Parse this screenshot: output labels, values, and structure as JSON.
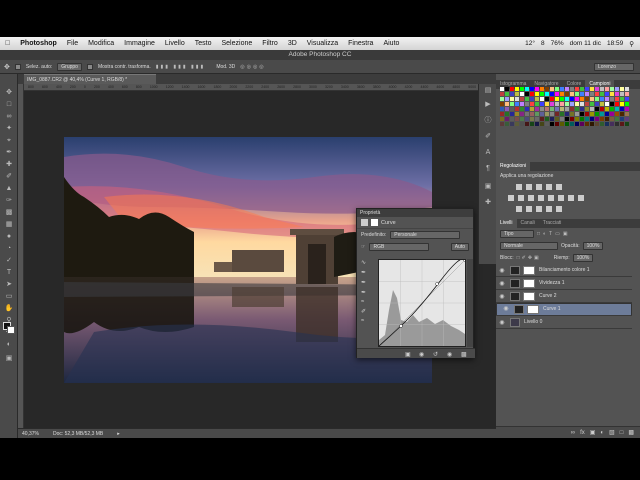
{
  "menubar": {
    "app": "Photoshop",
    "items": [
      "File",
      "Modifica",
      "Immagine",
      "Livello",
      "Testo",
      "Selezione",
      "Filtro",
      "3D",
      "Visualizza",
      "Finestra",
      "Aiuto"
    ],
    "status": [
      "12°",
      "8",
      "76%",
      "dom 11 dic",
      "18:59"
    ]
  },
  "window": {
    "title": "Adobe Photoshop CC"
  },
  "options": {
    "auto_select_label": "Selez. auto:",
    "auto_select_value": "Gruppo",
    "transform_label": "Mostra contr. trasforma.",
    "mode_label": "Mod. 3D",
    "workspace": "Lorenzo"
  },
  "document": {
    "tab": "IMG_0887.CR2 @ 40,4% (Curve 1, RGB/8) *",
    "zoom": "40,37%",
    "doc_size": "Doc: 52,3 MB/52,3 MB"
  },
  "ruler_ticks": [
    "800",
    "600",
    "400",
    "200",
    "0",
    "200",
    "400",
    "600",
    "800",
    "1000",
    "1200",
    "1400",
    "1600",
    "1800",
    "2000",
    "2200",
    "2400",
    "2600",
    "2800",
    "3000",
    "3200",
    "3400",
    "3600",
    "3800",
    "4000",
    "4200",
    "4400",
    "4600",
    "4800",
    "5000",
    "5200"
  ],
  "properties": {
    "title": "Proprietà",
    "subtitle": "Curve",
    "preset_label": "Predefinito:",
    "preset_value": "Personale",
    "channel": "RGB",
    "auto_button": "Auto"
  },
  "panels": {
    "top_tabs": [
      "Istogramma",
      "Navigatore",
      "Colore",
      "Campioni"
    ],
    "adj_tabs": [
      "Regolazioni"
    ],
    "adj_hint": "Applica una regolazione",
    "layer_tabs": [
      "Livelli",
      "Canali",
      "Tracciati"
    ],
    "kind_label": "Tipo",
    "blend_mode": "Normale",
    "opacity_label": "Opacità:",
    "opacity_value": "100%",
    "lock_label": "Blocc:",
    "fill_label": "Riemp:",
    "fill_value": "100%"
  },
  "layers": [
    {
      "name": "Bilanciamento colore 1",
      "selected": false
    },
    {
      "name": "Vividezza 1",
      "selected": false
    },
    {
      "name": "Curve 2",
      "selected": false
    },
    {
      "name": "Curve 1",
      "selected": true
    },
    {
      "name": "Livello 0",
      "selected": false
    }
  ],
  "swatch_colors": [
    "#ffffff",
    "#000000",
    "#ff0000",
    "#ffff00",
    "#00ff00",
    "#00ffff",
    "#0000ff",
    "#ff00ff",
    "#ff7f00",
    "#7f3f00",
    "#ffbf7f",
    "#7fff7f",
    "#3f7fff",
    "#bf7fff",
    "#7f7f7f",
    "#ff3f3f",
    "#3fbf3f",
    "#3f3fff",
    "#ffdf3f",
    "#df3fdf",
    "#bfbfbf",
    "#ff9f9f",
    "#9fff9f",
    "#9f9fff",
    "#ffff9f",
    "#dfdfdf",
    "#c04040",
    "#40c040",
    "#4040c0",
    "#c0c040"
  ],
  "accent": "#6d7c99"
}
